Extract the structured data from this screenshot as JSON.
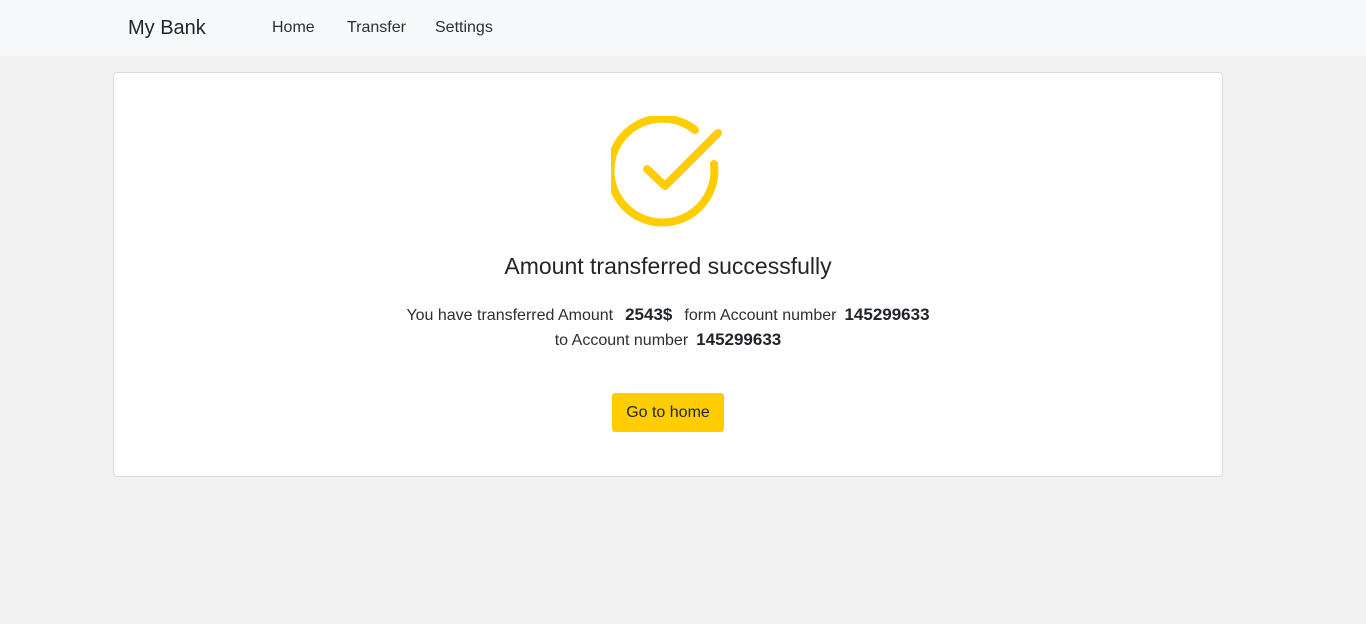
{
  "navbar": {
    "brand": "My Bank",
    "links": [
      {
        "label": "Home"
      },
      {
        "label": "Transfer"
      },
      {
        "label": "Settings"
      }
    ]
  },
  "success": {
    "icon": "check-circle-icon",
    "icon_color": "#ffcd00",
    "heading": "Amount transferred successfully",
    "line1_prefix": "You have transferred Amount",
    "amount": "2543$",
    "line1_mid": "form Account number",
    "from_account": "145299633",
    "line2_prefix": "to Account number",
    "to_account": "145299633",
    "button_label": "Go to home",
    "button_color": "#ffcd00"
  }
}
